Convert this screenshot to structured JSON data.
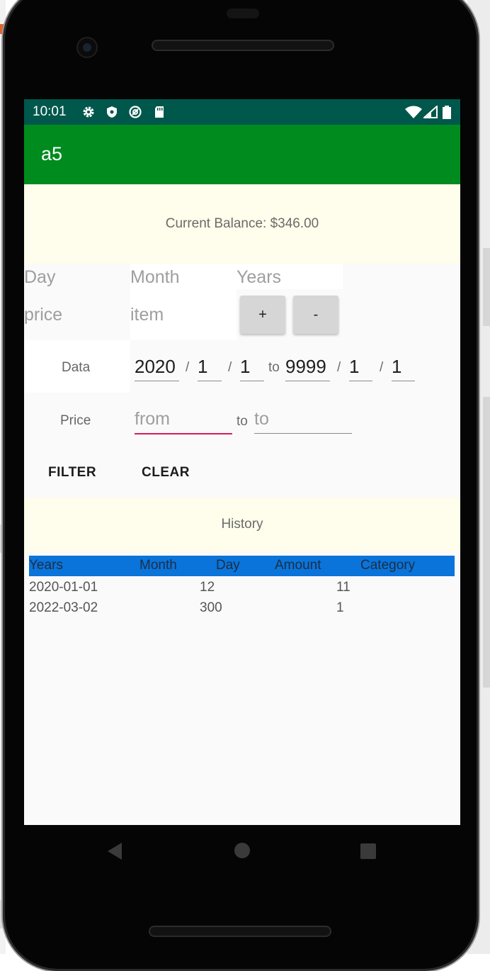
{
  "status_bar": {
    "time": "10:01",
    "left_icons": [
      "gear-icon",
      "shield-icon",
      "at-sign-icon",
      "sd-card-icon"
    ],
    "right_icons": [
      "wifi-icon",
      "cellular-icon",
      "battery-icon"
    ]
  },
  "app_bar": {
    "title": "a5",
    "color": "#008b1f"
  },
  "balance": {
    "text": "Current Balance: $346.00"
  },
  "entry": {
    "day_placeholder": "Day",
    "month_placeholder": "Month",
    "years_placeholder": "Years",
    "price_placeholder": "price",
    "item_placeholder": "item",
    "add_label": "+",
    "subtract_label": "-"
  },
  "date_filter": {
    "label": "Data",
    "from_year": "2020",
    "from_month": "1",
    "from_day": "1",
    "to_label": "to",
    "to_year": "9999",
    "to_month": "1",
    "to_day": "1",
    "separator": "/"
  },
  "price_filter": {
    "label": "Price",
    "from_placeholder": "from",
    "to_label": "to",
    "to_placeholder": "to",
    "focus_color": "#d81b60"
  },
  "actions": {
    "filter_label": "FILTER",
    "clear_label": "CLEAR"
  },
  "history": {
    "title": "History",
    "header_color": "#0a74da",
    "columns": [
      "Years",
      "Month",
      "Day",
      "Amount",
      "Category"
    ],
    "rows": [
      [
        "2020-01-01",
        "",
        "12",
        "",
        "11"
      ],
      [
        "2022-03-02",
        "",
        "300",
        "",
        "1"
      ]
    ]
  },
  "nav_bar": {
    "icons": [
      "back-icon",
      "home-icon",
      "recents-icon"
    ]
  }
}
